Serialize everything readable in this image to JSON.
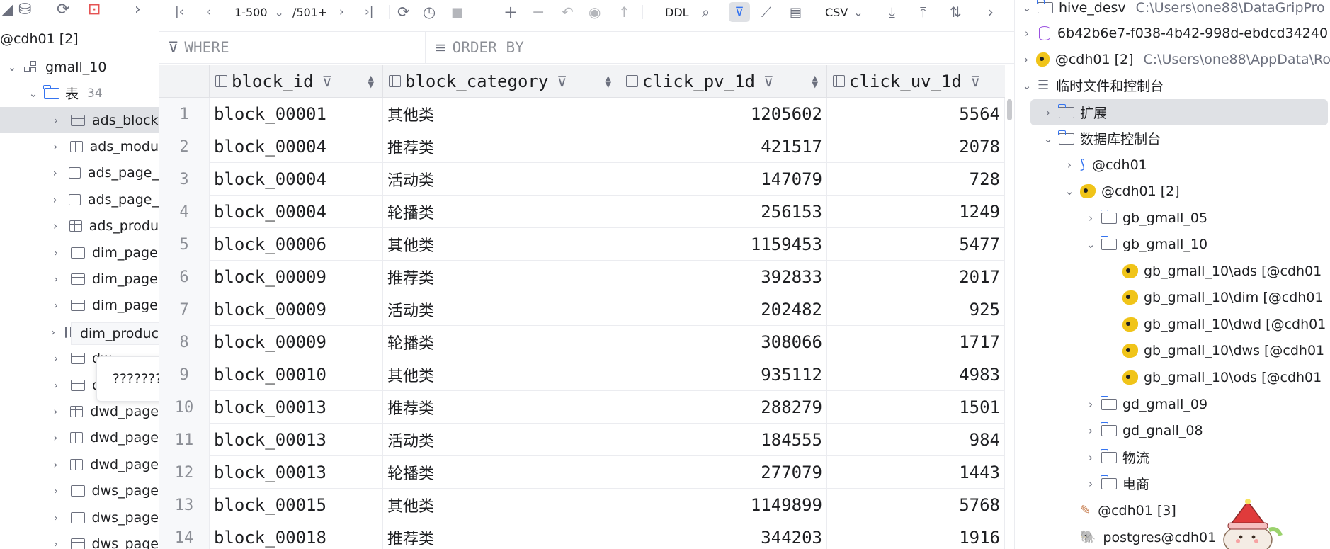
{
  "left": {
    "connection": "@cdh01 [2]",
    "schema": "gmall_10",
    "tables_folder": "表",
    "tables_count": "34",
    "tables": [
      "ads_block",
      "ads_modu",
      "ads_page_",
      "ads_page_",
      "ads_produ",
      "dim_page",
      "dim_page",
      "dim_page",
      "dim_product_info_zip",
      "dw",
      "dw",
      "dwd_page",
      "dwd_page",
      "dwd_page",
      "dws_page",
      "dws_page",
      "dws_page"
    ],
    "tooltip_name": "dim_product_info_zip",
    "tooltip_garbled": "?????????"
  },
  "toolbar": {
    "page_range": "1-500",
    "total_rows": "/501+",
    "ddl": "DDL",
    "export_format": "CSV"
  },
  "filter": {
    "where_label": "WHERE",
    "order_label": "ORDER BY"
  },
  "grid": {
    "columns": [
      "block_id",
      "block_category",
      "click_pv_1d",
      "click_uv_1d"
    ],
    "rows": [
      {
        "n": "1",
        "block_id": "block_00001",
        "category": "其他类",
        "pv": "1205602",
        "uv": "5564"
      },
      {
        "n": "2",
        "block_id": "block_00004",
        "category": "推荐类",
        "pv": "421517",
        "uv": "2078"
      },
      {
        "n": "3",
        "block_id": "block_00004",
        "category": "活动类",
        "pv": "147079",
        "uv": "728"
      },
      {
        "n": "4",
        "block_id": "block_00004",
        "category": "轮播类",
        "pv": "256153",
        "uv": "1249"
      },
      {
        "n": "5",
        "block_id": "block_00006",
        "category": "其他类",
        "pv": "1159453",
        "uv": "5477"
      },
      {
        "n": "6",
        "block_id": "block_00009",
        "category": "推荐类",
        "pv": "392833",
        "uv": "2017"
      },
      {
        "n": "7",
        "block_id": "block_00009",
        "category": "活动类",
        "pv": "202482",
        "uv": "925"
      },
      {
        "n": "8",
        "block_id": "block_00009",
        "category": "轮播类",
        "pv": "308066",
        "uv": "1717"
      },
      {
        "n": "9",
        "block_id": "block_00010",
        "category": "其他类",
        "pv": "935112",
        "uv": "4983"
      },
      {
        "n": "10",
        "block_id": "block_00013",
        "category": "推荐类",
        "pv": "288279",
        "uv": "1501"
      },
      {
        "n": "11",
        "block_id": "block_00013",
        "category": "活动类",
        "pv": "184555",
        "uv": "984"
      },
      {
        "n": "12",
        "block_id": "block_00013",
        "category": "轮播类",
        "pv": "277079",
        "uv": "1443"
      },
      {
        "n": "13",
        "block_id": "block_00015",
        "category": "其他类",
        "pv": "1149899",
        "uv": "5768"
      },
      {
        "n": "14",
        "block_id": "block_00018",
        "category": "推荐类",
        "pv": "344203",
        "uv": "1916"
      }
    ]
  },
  "right": {
    "items": [
      {
        "label": "hive_desv",
        "path": "C:\\Users\\one88\\DataGripPro"
      },
      {
        "label": "6b42b6e7-f038-4b42-998d-ebdcd34240"
      },
      {
        "label": "@cdh01 [2]",
        "path": "C:\\Users\\one88\\AppData\\Ro"
      },
      {
        "label": "临时文件和控制台"
      },
      {
        "label": "扩展"
      },
      {
        "label": "数据库控制台"
      },
      {
        "label": "@cdh01"
      },
      {
        "label": "@cdh01 [2]"
      },
      {
        "label": "gb_gmall_05"
      },
      {
        "label": "gb_gmall_10"
      },
      {
        "label": "gb_gmall_10\\ads [@cdh01"
      },
      {
        "label": "gb_gmall_10\\dim [@cdh01"
      },
      {
        "label": "gb_gmall_10\\dwd [@cdh01"
      },
      {
        "label": "gb_gmall_10\\dws [@cdh01"
      },
      {
        "label": "gb_gmall_10\\ods [@cdh01"
      },
      {
        "label": "gd_gmall_09"
      },
      {
        "label": "gd_gnall_08"
      },
      {
        "label": "物流"
      },
      {
        "label": "电商"
      },
      {
        "label": "@cdh01 [3]"
      },
      {
        "label": "postgres@cdh01"
      }
    ]
  }
}
